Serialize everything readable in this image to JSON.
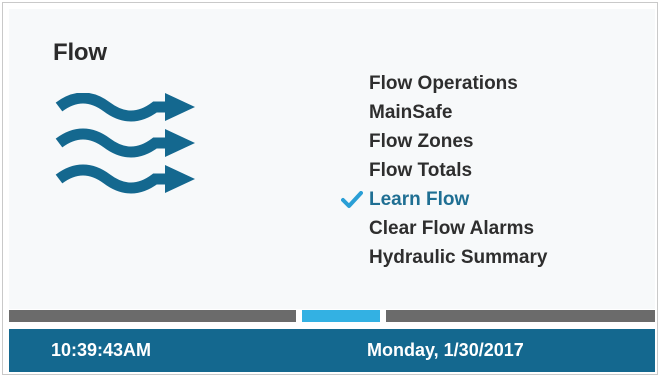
{
  "screen": {
    "title": "Flow",
    "icon": "flow-waves-icon"
  },
  "menu": {
    "items": [
      {
        "label": "Flow Operations",
        "selected": false
      },
      {
        "label": "MainSafe",
        "selected": false
      },
      {
        "label": "Flow Zones",
        "selected": false
      },
      {
        "label": "Flow Totals",
        "selected": false
      },
      {
        "label": "Learn Flow",
        "selected": true,
        "icon": "checkmark-icon"
      },
      {
        "label": "Clear Flow Alarms",
        "selected": false
      },
      {
        "label": "Hydraulic Summary",
        "selected": false
      }
    ]
  },
  "progress": {
    "position_fraction": 0.5
  },
  "status_bar": {
    "time": "10:39:43AM",
    "date": "Monday, 1/30/2017"
  },
  "colors": {
    "accent": "#14688f",
    "selected_text": "#1f6f93",
    "check": "#2a9fd6",
    "indicator": "#33b1e3",
    "indicator_track": "#6b6b6b"
  }
}
